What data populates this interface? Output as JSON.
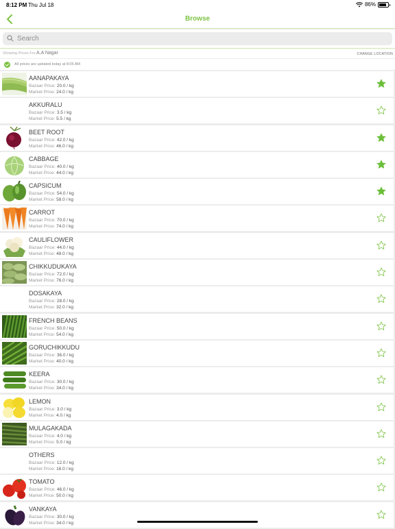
{
  "status": {
    "time": "8:12 PM",
    "date": "Thu Jul 18",
    "battery": "86%",
    "battery_level": 0.86
  },
  "nav": {
    "title": "Browse"
  },
  "search": {
    "placeholder": "Search"
  },
  "location": {
    "prefix": "Showing Prices For",
    "name": "A.A Nagar",
    "change_label": "CHANGE LOCATION"
  },
  "update": {
    "text": "All prices are updated today at 8:05 AM"
  },
  "colors": {
    "accent": "#7cc242",
    "fav_filled": "#6cbf3a"
  },
  "items": [
    {
      "name": "AANAPAKAYA",
      "bazaar_label": "Bazaar Price:",
      "bazaar": "20.0 / kg",
      "market_label": "Market Price:",
      "market": "24.0 / kg",
      "favorite": true,
      "icon": "bottle-gourd-image"
    },
    {
      "name": "AKKURALU",
      "bazaar_label": "Bazaar Price:",
      "bazaar": "3.5 / kg",
      "market_label": "Market Price:",
      "market": "5.5 / kg",
      "favorite": false,
      "icon": ""
    },
    {
      "name": "BEET ROOT",
      "bazaar_label": "Bazaar Price:",
      "bazaar": "42.0 / kg",
      "market_label": "Market Price:",
      "market": "46.0 / kg",
      "favorite": true,
      "icon": "beetroot-image"
    },
    {
      "name": "CABBAGE",
      "bazaar_label": "Bazaar Price:",
      "bazaar": "40.0 / kg",
      "market_label": "Market Price:",
      "market": "44.0 / kg",
      "favorite": true,
      "icon": "cabbage-image"
    },
    {
      "name": "CAPSICUM",
      "bazaar_label": "Bazaar Price:",
      "bazaar": "54.0 / kg",
      "market_label": "Market Price:",
      "market": "58.0 / kg",
      "favorite": true,
      "icon": "capsicum-image"
    },
    {
      "name": "CARROT",
      "bazaar_label": "Bazaar Price:",
      "bazaar": "70.0 / kg",
      "market_label": "Market Price:",
      "market": "74.0 / kg",
      "favorite": false,
      "icon": "carrot-image"
    },
    {
      "name": "CAULIFLOWER",
      "bazaar_label": "Bazaar Price:",
      "bazaar": "44.0 / kg",
      "market_label": "Market Price:",
      "market": "48.0 / kg",
      "favorite": false,
      "icon": "cauliflower-image"
    },
    {
      "name": "CHIKKUDUKAYA",
      "bazaar_label": "Bazaar Price:",
      "bazaar": "72.0 / kg",
      "market_label": "Market Price:",
      "market": "76.0 / kg",
      "favorite": false,
      "icon": "broad-beans-image"
    },
    {
      "name": "DOSAKAYA",
      "bazaar_label": "Bazaar Price:",
      "bazaar": "28.0 / kg",
      "market_label": "Market Price:",
      "market": "32.0 / kg",
      "favorite": false,
      "icon": ""
    },
    {
      "name": "FRENCH BEANS",
      "bazaar_label": "Bazaar Price:",
      "bazaar": "50.0 / kg",
      "market_label": "Market Price:",
      "market": "54.0 / kg",
      "favorite": false,
      "icon": "french-beans-image"
    },
    {
      "name": "GORUCHIKKUDU",
      "bazaar_label": "Bazaar Price:",
      "bazaar": "36.0 / kg",
      "market_label": "Market Price:",
      "market": "40.0 / kg",
      "favorite": false,
      "icon": "cluster-beans-image"
    },
    {
      "name": "KEERA",
      "bazaar_label": "Bazaar Price:",
      "bazaar": "30.0 / kg",
      "market_label": "Market Price:",
      "market": "34.0 / kg",
      "favorite": false,
      "icon": "cucumber-image"
    },
    {
      "name": "LEMON",
      "bazaar_label": "Bazaar Price:",
      "bazaar": "3.0 / kg",
      "market_label": "Market Price:",
      "market": "4.0 / kg",
      "favorite": false,
      "icon": "lemon-image"
    },
    {
      "name": "MULAGAKADA",
      "bazaar_label": "Bazaar Price:",
      "bazaar": "4.0 / kg",
      "market_label": "Market Price:",
      "market": "5.0 / kg",
      "favorite": false,
      "icon": "drumstick-image"
    },
    {
      "name": "OTHERS",
      "bazaar_label": "Bazaar Price:",
      "bazaar": "12.0 / kg",
      "market_label": "Market Price:",
      "market": "16.0 / kg",
      "favorite": false,
      "icon": ""
    },
    {
      "name": "TOMATO",
      "bazaar_label": "Bazaar Price:",
      "bazaar": "46.0 / kg",
      "market_label": "Market Price:",
      "market": "50.0 / kg",
      "favorite": false,
      "icon": "tomato-image"
    },
    {
      "name": "VANKAYA",
      "bazaar_label": "Bazaar Price:",
      "bazaar": "30.0 / kg",
      "market_label": "Market Price:",
      "market": "34.0 / kg",
      "favorite": false,
      "icon": "brinjal-image"
    }
  ]
}
